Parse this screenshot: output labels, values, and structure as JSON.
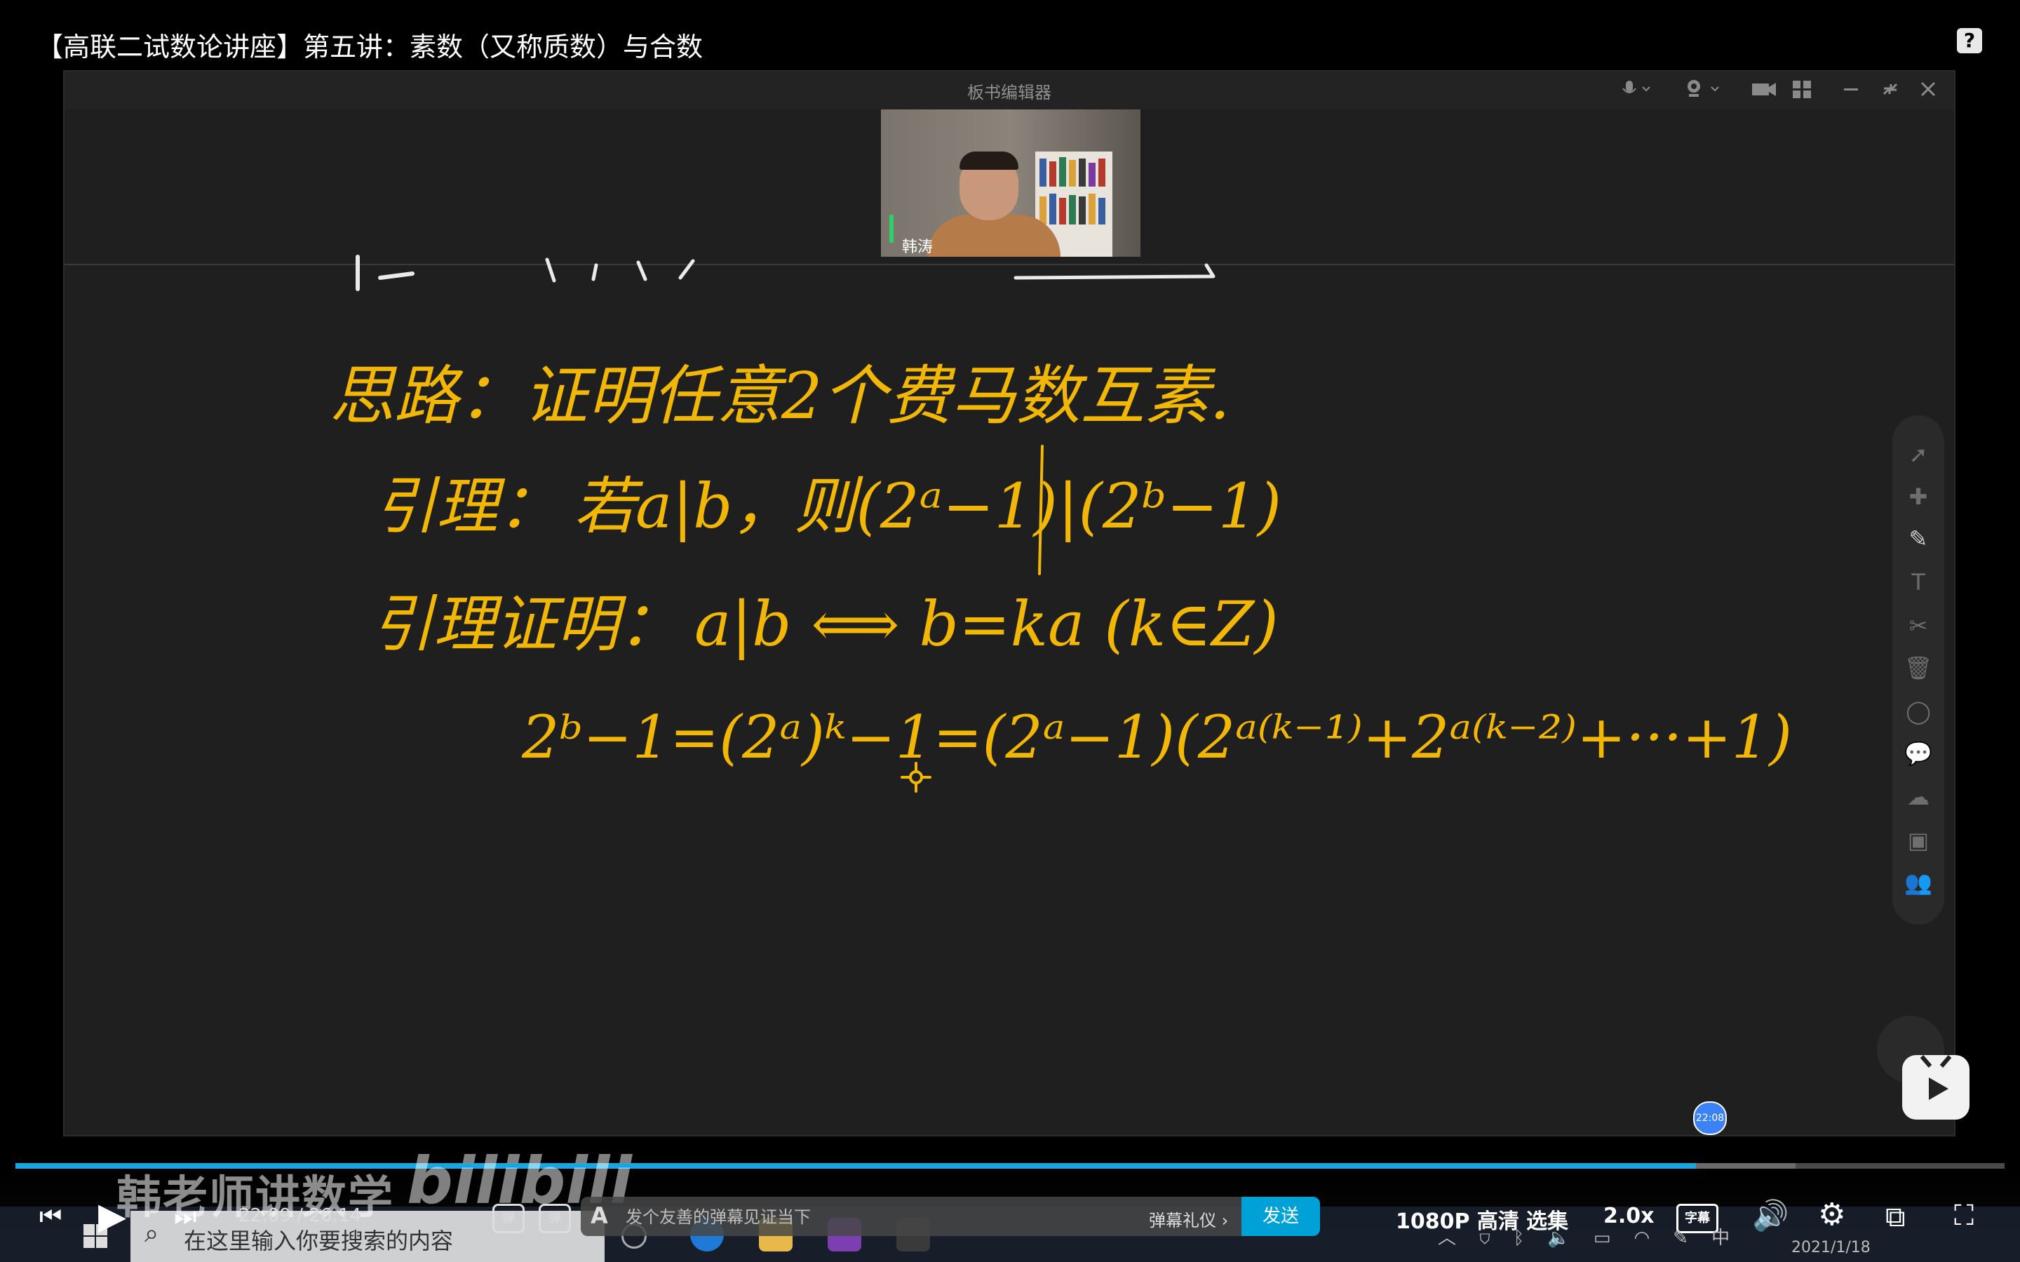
{
  "video": {
    "title": "【高联二试数论讲座】第五讲：素数（又称质数）与合数"
  },
  "board": {
    "window_title": "板书编辑器",
    "titlebar_icons": [
      "microphone-icon",
      "webcam-icon",
      "camera-icon",
      "grid-icon",
      "minimize-icon",
      "restore-icon",
      "close-icon"
    ],
    "webcam_name": "韩涛",
    "side_tools": [
      "select-icon",
      "add-cursor-icon",
      "pen-icon",
      "text-icon",
      "scissors-icon",
      "trash-icon",
      "shape-icon",
      "chat-icon",
      "cloud-icon",
      "toolbox-icon",
      "users-icon"
    ],
    "handwriting": {
      "line1": "思路：证明任意2个费马数互素.",
      "line2_label": "引理：",
      "line2_text": "若a|b，则(2ᵃ−1)|(2ᵇ−1)",
      "line3_label": "引理证明：",
      "line3_text": "a|b ⟺ b=ka (k∈Z)",
      "line4_text": "2ᵇ−1=(2ᵃ)ᵏ−1=(2ᵃ−1)(2ᵃ⁽ᵏ⁻¹⁾+2ᵃ⁽ᵏ⁻²⁾+···+1)"
    },
    "time_bubble": "22:08"
  },
  "player": {
    "current_time": "22:09",
    "separator": "/",
    "duration": "26:14",
    "progress": 0.845,
    "buffered": 0.895,
    "danmaku_toggle": "弹",
    "danmaku_settings": "弹",
    "danmaku_placeholder": "发个友善的弹幕见证当下",
    "danmaku_etiquette": "弹幕礼仪 ›",
    "send_label": "发送",
    "quality": "1080P 高清",
    "episodes": "选集",
    "speed": "2.0x",
    "subtitle": "字幕",
    "watermark": "韩老师讲数学",
    "watermark_logo": "bilibili"
  },
  "taskbar": {
    "search_placeholder": "在这里输入你要搜索的内容",
    "tray_ime": "中",
    "date": "2021/1/18"
  },
  "colors": {
    "ink": "#f2b705",
    "progress": "#19a6e0",
    "send": "#00a1d6"
  }
}
